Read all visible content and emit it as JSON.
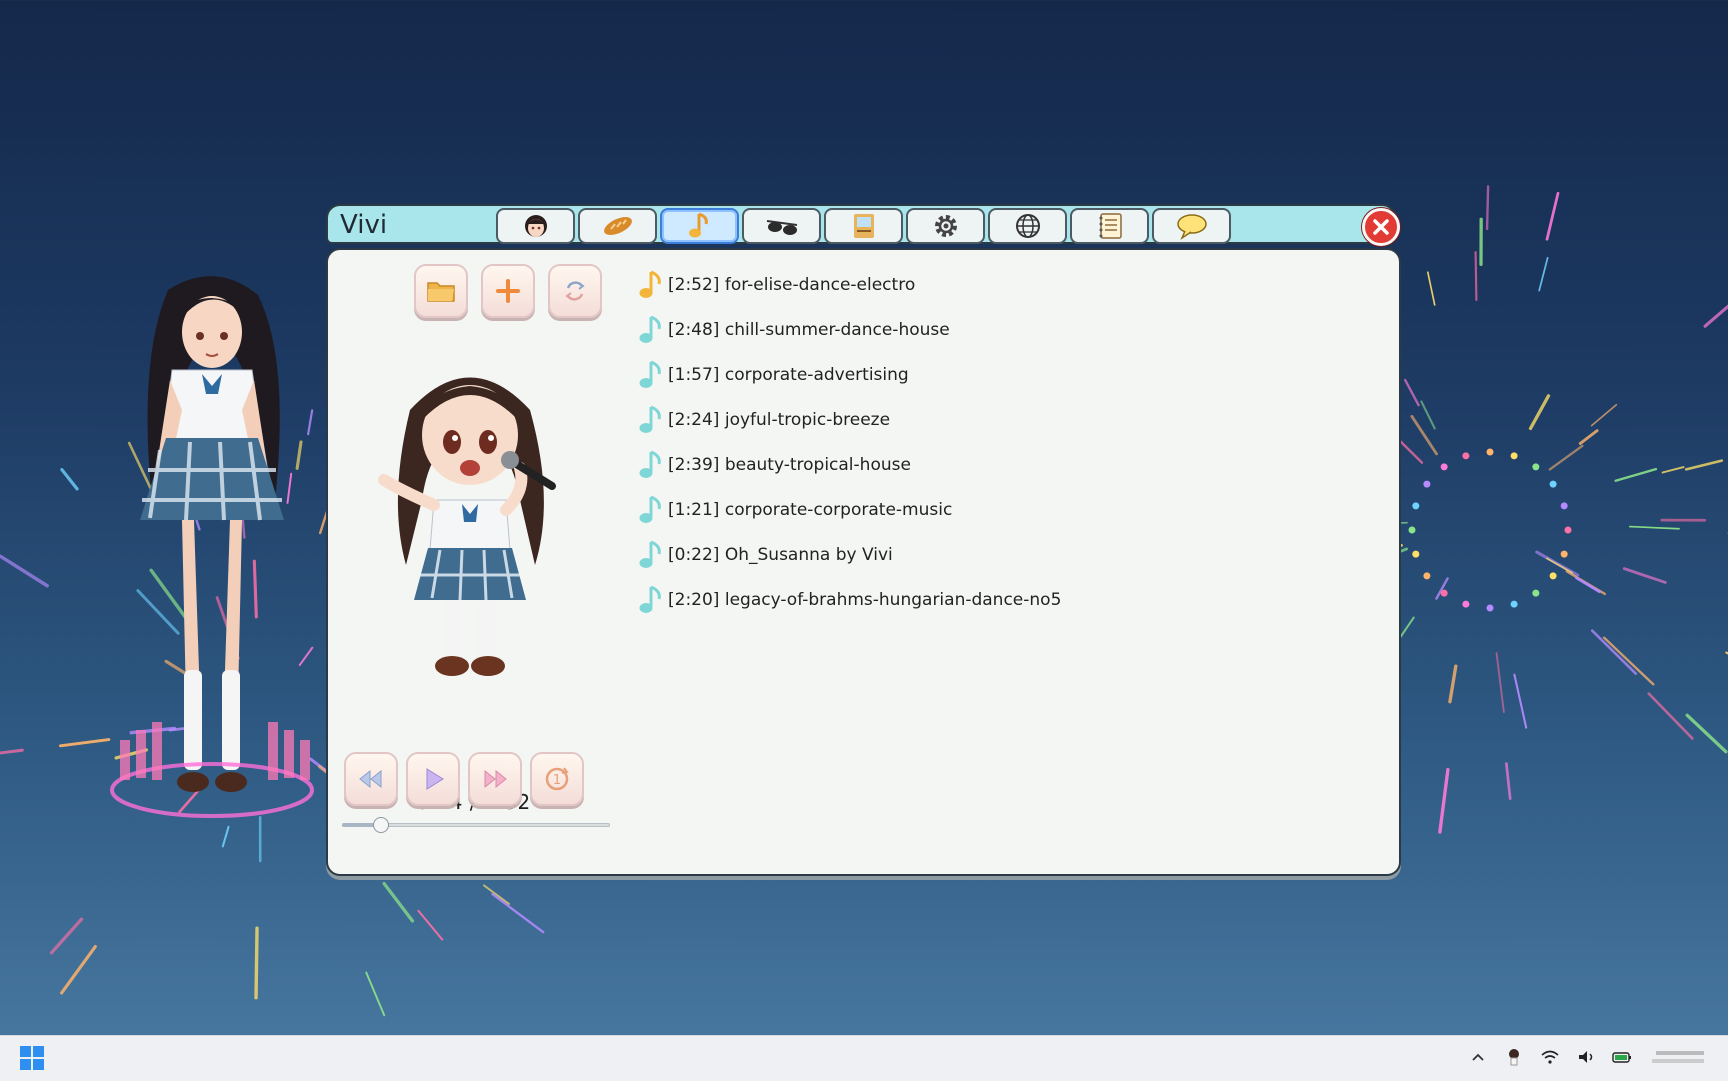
{
  "window": {
    "title": "Vivi",
    "tabs": [
      {
        "icon": "avatar-icon",
        "active": false
      },
      {
        "icon": "bread-icon",
        "active": false
      },
      {
        "icon": "music-note-icon",
        "active": true
      },
      {
        "icon": "sunglasses-icon",
        "active": false
      },
      {
        "icon": "book-icon",
        "active": false
      },
      {
        "icon": "gear-icon",
        "active": false
      },
      {
        "icon": "globe-icon",
        "active": false
      },
      {
        "icon": "notebook-icon",
        "active": false
      },
      {
        "icon": "speech-bubble-icon",
        "active": false
      }
    ],
    "close_icon": "close-icon"
  },
  "toolbar": {
    "buttons": [
      "folder-icon",
      "add-icon",
      "refresh-icon"
    ]
  },
  "playlist": {
    "tracks": [
      {
        "label": "[2:52] for-elise-dance-electro",
        "playing": true
      },
      {
        "label": "[2:48] chill-summer-dance-house",
        "playing": false
      },
      {
        "label": "[1:57] corporate-advertising",
        "playing": false
      },
      {
        "label": "[2:24] joyful-tropic-breeze",
        "playing": false
      },
      {
        "label": "[2:39] beauty-tropical-house",
        "playing": false
      },
      {
        "label": "[1:21] corporate-corporate-music",
        "playing": false
      },
      {
        "label": "[0:22] Oh_Susanna by Vivi",
        "playing": false
      },
      {
        "label": "[2:20] legacy-of-brahms-hungarian-dance-no5",
        "playing": false
      }
    ]
  },
  "player": {
    "time": "0:24 / 2:52",
    "progress": 0.14,
    "controls": [
      "rewind-icon",
      "play-icon",
      "fast-forward-icon",
      "repeat-one-icon"
    ]
  },
  "colors": {
    "titlebar": "#a8e6ec",
    "panel": "#f4f6f4",
    "playing_note": "#f2b53a",
    "note": "#7fd6d6",
    "close": "#e23a34"
  }
}
